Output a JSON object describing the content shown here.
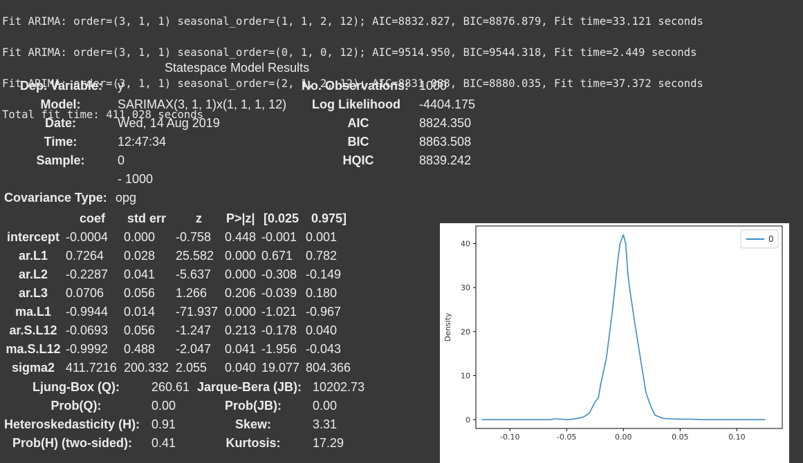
{
  "log_lines": [
    "Fit ARIMA: order=(3, 1, 1) seasonal_order=(1, 1, 2, 12); AIC=8832.827, BIC=8876.879, Fit time=33.121 seconds",
    "Fit ARIMA: order=(3, 1, 1) seasonal_order=(0, 1, 0, 12); AIC=9514.950, BIC=9544.318, Fit time=2.449 seconds",
    "Fit ARIMA: order=(3, 1, 1) seasonal_order=(2, 1, 2, 12); AIC=8831.088, BIC=8880.035, Fit time=37.372 seconds",
    "Total fit time: 411.028 seconds"
  ],
  "summary": {
    "caption": "Statespace Model Results",
    "left": [
      {
        "label": "Dep. Variable:",
        "value": "y"
      },
      {
        "label": "Model:",
        "value": "SARIMAX(3, 1, 1)x(1, 1, 1, 12)"
      },
      {
        "label": "Date:",
        "value": "Wed, 14 Aug 2019"
      },
      {
        "label": "Time:",
        "value": "12:47:34"
      },
      {
        "label": "Sample:",
        "value": "0"
      },
      {
        "label": "",
        "value": "- 1000"
      },
      {
        "label": "Covariance Type:",
        "value": "opg"
      }
    ],
    "right": [
      {
        "label": "No. Observations:",
        "value": "1000"
      },
      {
        "label": "Log Likelihood",
        "value": "-4404.175"
      },
      {
        "label": "AIC",
        "value": "8824.350"
      },
      {
        "label": "BIC",
        "value": "8863.508"
      },
      {
        "label": "HQIC",
        "value": "8839.242"
      }
    ]
  },
  "coef_table": {
    "headers": [
      "coef",
      "std err",
      "z",
      "P>|z|",
      "[0.025",
      "0.975]"
    ],
    "rows": [
      {
        "name": "intercept",
        "cells": [
          "-0.0004",
          "0.000",
          "-0.758",
          "0.448",
          "-0.001",
          "0.001"
        ]
      },
      {
        "name": "ar.L1",
        "cells": [
          "0.7264",
          "0.028",
          "25.582",
          "0.000",
          "0.671",
          "0.782"
        ]
      },
      {
        "name": "ar.L2",
        "cells": [
          "-0.2287",
          "0.041",
          "-5.637",
          "0.000",
          "-0.308",
          "-0.149"
        ]
      },
      {
        "name": "ar.L3",
        "cells": [
          "0.0706",
          "0.056",
          "1.266",
          "0.206",
          "-0.039",
          "0.180"
        ]
      },
      {
        "name": "ma.L1",
        "cells": [
          "-0.9944",
          "0.014",
          "-71.937",
          "0.000",
          "-1.021",
          "-0.967"
        ]
      },
      {
        "name": "ar.S.L12",
        "cells": [
          "-0.0693",
          "0.056",
          "-1.247",
          "0.213",
          "-0.178",
          "0.040"
        ]
      },
      {
        "name": "ma.S.L12",
        "cells": [
          "-0.9992",
          "0.488",
          "-2.047",
          "0.041",
          "-1.956",
          "-0.043"
        ]
      },
      {
        "name": "sigma2",
        "cells": [
          "411.7216",
          "200.332",
          "2.055",
          "0.040",
          "19.077",
          "804.366"
        ]
      }
    ]
  },
  "diagnostics": [
    {
      "l_label": "Ljung-Box (Q):",
      "l_value": "260.61",
      "r_label": "Jarque-Bera (JB):",
      "r_value": "10202.73"
    },
    {
      "l_label": "Prob(Q):",
      "l_value": "0.00",
      "r_label": "Prob(JB):",
      "r_value": "0.00"
    },
    {
      "l_label": "Heteroskedasticity (H):",
      "l_value": "0.91",
      "r_label": "Skew:",
      "r_value": "3.31"
    },
    {
      "l_label": "Prob(H) (two-sided):",
      "l_value": "0.41",
      "r_label": "Kurtosis:",
      "r_value": "17.29"
    }
  ],
  "chart_data": {
    "type": "line",
    "ylabel": "Density",
    "xlim": [
      -0.13,
      0.14
    ],
    "ylim": [
      -2,
      44
    ],
    "xticks": [
      "-0.10",
      "-0.05",
      "0.00",
      "0.05",
      "0.10"
    ],
    "xtick_values": [
      -0.1,
      -0.05,
      0.0,
      0.05,
      0.1
    ],
    "yticks": [
      "0",
      "10",
      "20",
      "30",
      "40"
    ],
    "ytick_values": [
      0,
      10,
      20,
      30,
      40
    ],
    "legend": {
      "placement": "top-right"
    },
    "series": [
      {
        "name": "0",
        "color": "#3b8bc4",
        "x": [
          -0.125,
          -0.1,
          -0.08,
          -0.065,
          -0.06,
          -0.055,
          -0.05,
          -0.045,
          -0.04,
          -0.035,
          -0.03,
          -0.025,
          -0.022,
          -0.02,
          -0.015,
          -0.01,
          -0.007,
          -0.005,
          -0.003,
          0.0,
          0.002,
          0.004,
          0.006,
          0.01,
          0.015,
          0.02,
          0.025,
          0.028,
          0.03,
          0.035,
          0.04,
          0.05,
          0.06,
          0.07,
          0.08,
          0.1,
          0.125
        ],
        "y": [
          0.0,
          0.0,
          0.0,
          0.0,
          0.2,
          0.1,
          0.0,
          0.1,
          0.3,
          0.6,
          1.5,
          4.0,
          5.0,
          8.0,
          14.0,
          24.0,
          31.0,
          36.0,
          40.0,
          42.0,
          40.0,
          33.0,
          29.0,
          22.0,
          14.0,
          6.0,
          2.5,
          1.0,
          0.8,
          0.3,
          0.2,
          0.1,
          0.1,
          0.0,
          0.0,
          0.0,
          0.0
        ]
      }
    ]
  }
}
